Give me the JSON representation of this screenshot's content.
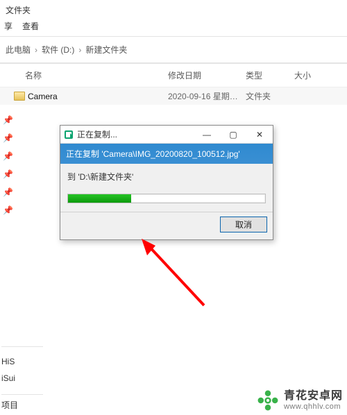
{
  "window": {
    "title": "文件夹"
  },
  "toolbar": {
    "share": "享",
    "view": "查看"
  },
  "breadcrumb": {
    "root": "此电脑",
    "drive": "软件 (D:)",
    "folder": "新建文件夹"
  },
  "columns": {
    "name": "名称",
    "date": "修改日期",
    "type": "类型",
    "size": "大小"
  },
  "rows": [
    {
      "name": "Camera",
      "date": "2020-09-16 星期…",
      "type": "文件夹"
    }
  ],
  "dialog": {
    "title": "正在复制...",
    "heading": "正在复制 'Camera\\IMG_20200820_100512.jpg'",
    "dest": "到 'D:\\新建文件夹'",
    "progress_pct": 32,
    "cancel": "取消"
  },
  "sidebar": {
    "item1": "HiS",
    "item2": "iSui",
    "footer": "项目"
  },
  "watermark": {
    "cn": "青花安卓网",
    "url": "www.qhhlv.com"
  }
}
